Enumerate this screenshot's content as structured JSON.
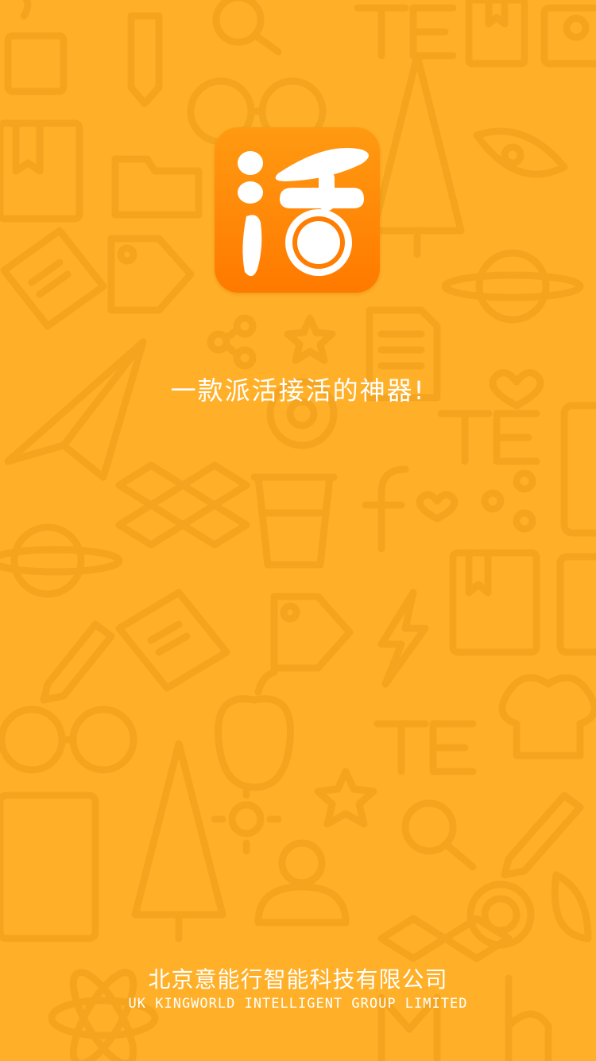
{
  "splash": {
    "background_color": "#FFB028",
    "pattern_color": "#F4A41E",
    "app_icon": {
      "glyph": "活",
      "icon_name": "huo-app-icon",
      "gradient_top": "#FF9A12",
      "gradient_bottom": "#FF7A00"
    },
    "tagline": "一款派活接活的神器!",
    "company_name_cn": "北京意能行智能科技有限公司",
    "company_name_en": "UK KINGWORLD INTELLIGENT GROUP LIMITED"
  }
}
